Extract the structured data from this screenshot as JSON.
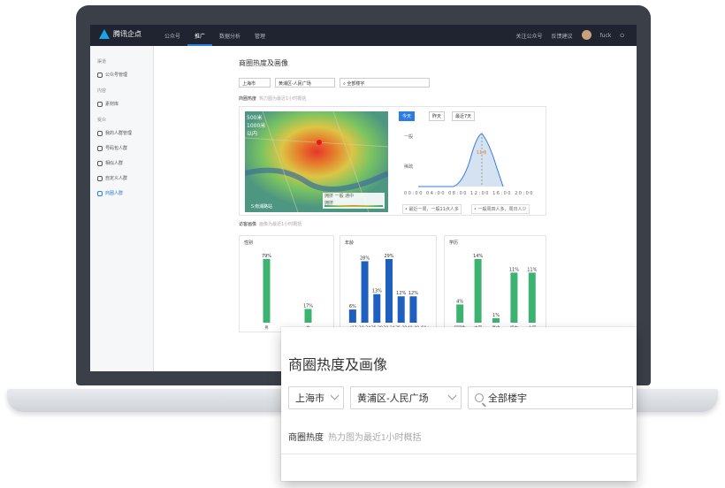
{
  "app": {
    "logo_text": "腾讯企点",
    "nav": [
      "公众号",
      "推广",
      "数据分析",
      "管理"
    ],
    "nav_active": "推广",
    "right_links": [
      "关注公众号",
      "反馈建议"
    ],
    "user_name": "fuck"
  },
  "sidebar": {
    "groups": [
      {
        "label": "渠道",
        "items": [
          "公众号管理"
        ]
      },
      {
        "label": "内容",
        "items": [
          "素材库"
        ]
      },
      {
        "label": "受众",
        "items": [
          "我的人群管理",
          "号码包人群",
          "相似人群",
          "自定义人群",
          "商圈人群"
        ]
      }
    ],
    "active_item": "商圈人群"
  },
  "page": {
    "title": "商圈热度及画像",
    "city": "上海市",
    "district": "黄浦区-人民广场",
    "building_search": "全部楼宇",
    "heat_label": "商圈热度",
    "heat_sub": "热力图为最近1小时概括",
    "visitor_label": "访客画像",
    "visitor_sub": "画像为最近1小时概括"
  },
  "map": {
    "tl_text": "500米\n1000米\n以内",
    "legend": "拥挤 一般 通中",
    "legend2": "拥挤",
    "corner": "Ｓ南浦路站"
  },
  "trend": {
    "tabs": [
      "今天",
      "昨天",
      "最近7天"
    ],
    "active_tab": "今天",
    "y_labels": [
      "一般",
      "稀疏"
    ],
    "x_labels": [
      "00:00",
      "04:00",
      "08:00",
      "12:00",
      "16:00",
      "20:00"
    ],
    "highlight": "11点",
    "notes": [
      "• 最近一周，一般11点人多",
      "• 一般周四人多，周日人少"
    ]
  },
  "chart_data": [
    {
      "type": "bar",
      "title": "性别",
      "categories": [
        "男",
        "女"
      ],
      "values": [
        79,
        17
      ],
      "colors": [
        "#3cb371"
      ]
    },
    {
      "type": "bar",
      "title": "年龄",
      "categories": [
        "<17",
        "18-24",
        "25-29",
        "30-34",
        "35-39",
        "40-49",
        "50+"
      ],
      "values": [
        6,
        28,
        13,
        29,
        12,
        12,
        0
      ],
      "labels": [
        "6%",
        "28%",
        "13%",
        "29%",
        "12%",
        "12%",
        ""
      ],
      "colors": [
        "#1f5fbf"
      ]
    },
    {
      "type": "bar",
      "title": "学历",
      "categories": [
        "研究生",
        "大学",
        "高中",
        "初中",
        "小学"
      ],
      "values": [
        4,
        14,
        1,
        11,
        11
      ],
      "labels": [
        "4%",
        "14%",
        "1%",
        "11%",
        "11%"
      ],
      "colors": [
        "#3cb371"
      ]
    }
  ],
  "zoom": {
    "title": "商圈热度及画像",
    "city": "上海市",
    "district": "黄浦区-人民广场",
    "building_search": "全部楼宇",
    "heat_label": "商圈热度",
    "heat_sub": "热力图为最近1小时概括"
  }
}
